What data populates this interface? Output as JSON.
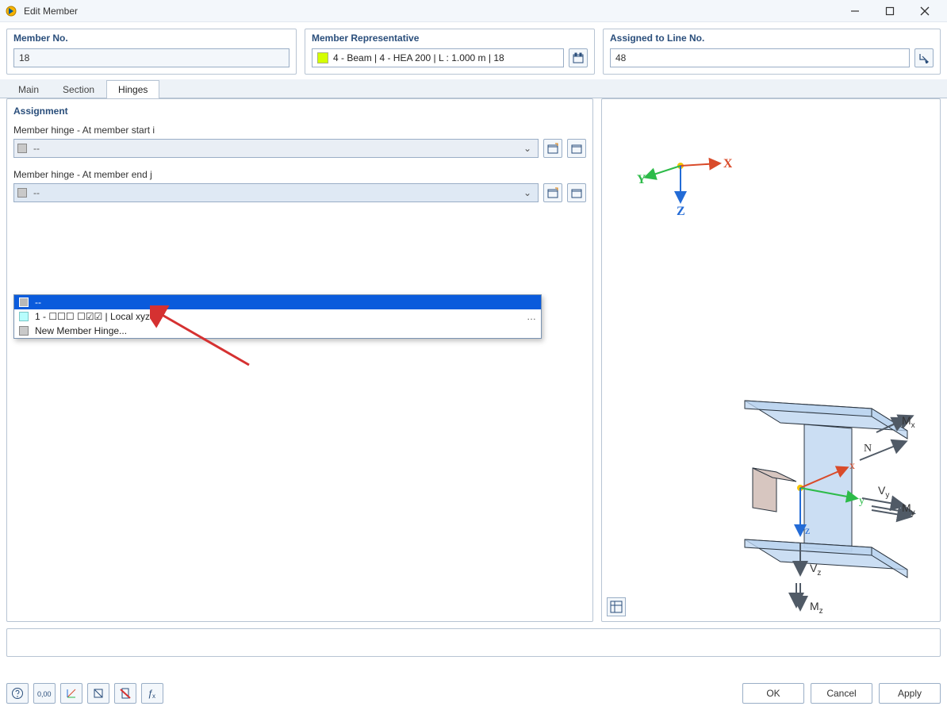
{
  "window": {
    "title": "Edit Member"
  },
  "top": {
    "member_no_label": "Member No.",
    "member_no": "18",
    "rep_label": "Member Representative",
    "rep_value": "4 - Beam | 4 - HEA 200 | L : 1.000 m | 18",
    "line_label": "Assigned to Line No.",
    "line_value": "48"
  },
  "tabs": {
    "a": "Main",
    "b": "Section",
    "c": "Hinges",
    "active": "Hinges"
  },
  "assign": {
    "title": "Assignment",
    "start_label": "Member hinge - At member start i",
    "end_label": "Member hinge - At member end j",
    "placeholder": "--"
  },
  "dropdown": {
    "opt_none": "--",
    "opt_hinge": "1 - ☐☐☐  ☐☑☑ | Local xyz",
    "opt_new": "New Member Hinge...",
    "dots": "…"
  },
  "axes": {
    "X": "X",
    "Y": "Y",
    "Z": "Z"
  },
  "diagram": {
    "x": "x",
    "y": "y",
    "z": "z",
    "N": "N",
    "Mx": "M",
    "My": "M",
    "Mz": "M",
    "Vy": "V",
    "Vz": "V",
    "sub_x": "x",
    "sub_y": "y",
    "sub_z": "z"
  },
  "buttons": {
    "ok": "OK",
    "cancel": "Cancel",
    "apply": "Apply"
  },
  "notes_placeholder": ""
}
